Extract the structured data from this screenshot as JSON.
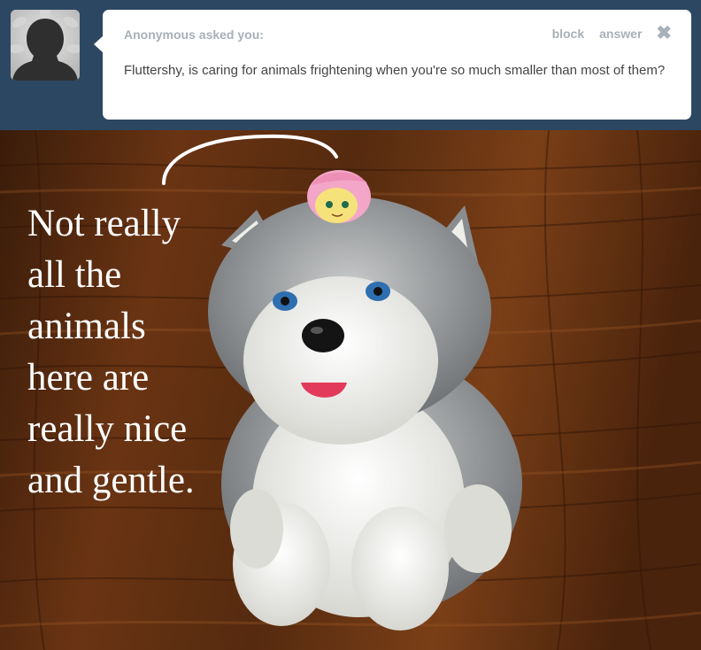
{
  "ask": {
    "asker_text": "Anonymous asked you:",
    "question_text": "Fluttershy, is caring for animals frightening when you're so much smaller than most of them?",
    "actions": {
      "block_label": "block",
      "answer_label": "answer",
      "close_glyph": "✖"
    }
  },
  "caption": {
    "lines": [
      "Not really",
      "all the",
      "animals",
      "here are",
      "really nice",
      "and gentle."
    ]
  },
  "icons": {
    "avatar": "anonymous-silhouette-icon",
    "close": "close-icon"
  },
  "colors": {
    "header_bg": "#2c4762",
    "bubble_bg": "#ffffff",
    "muted_text": "#a8b0b8",
    "question_text": "#444444",
    "caption_text": "#ffffff"
  }
}
